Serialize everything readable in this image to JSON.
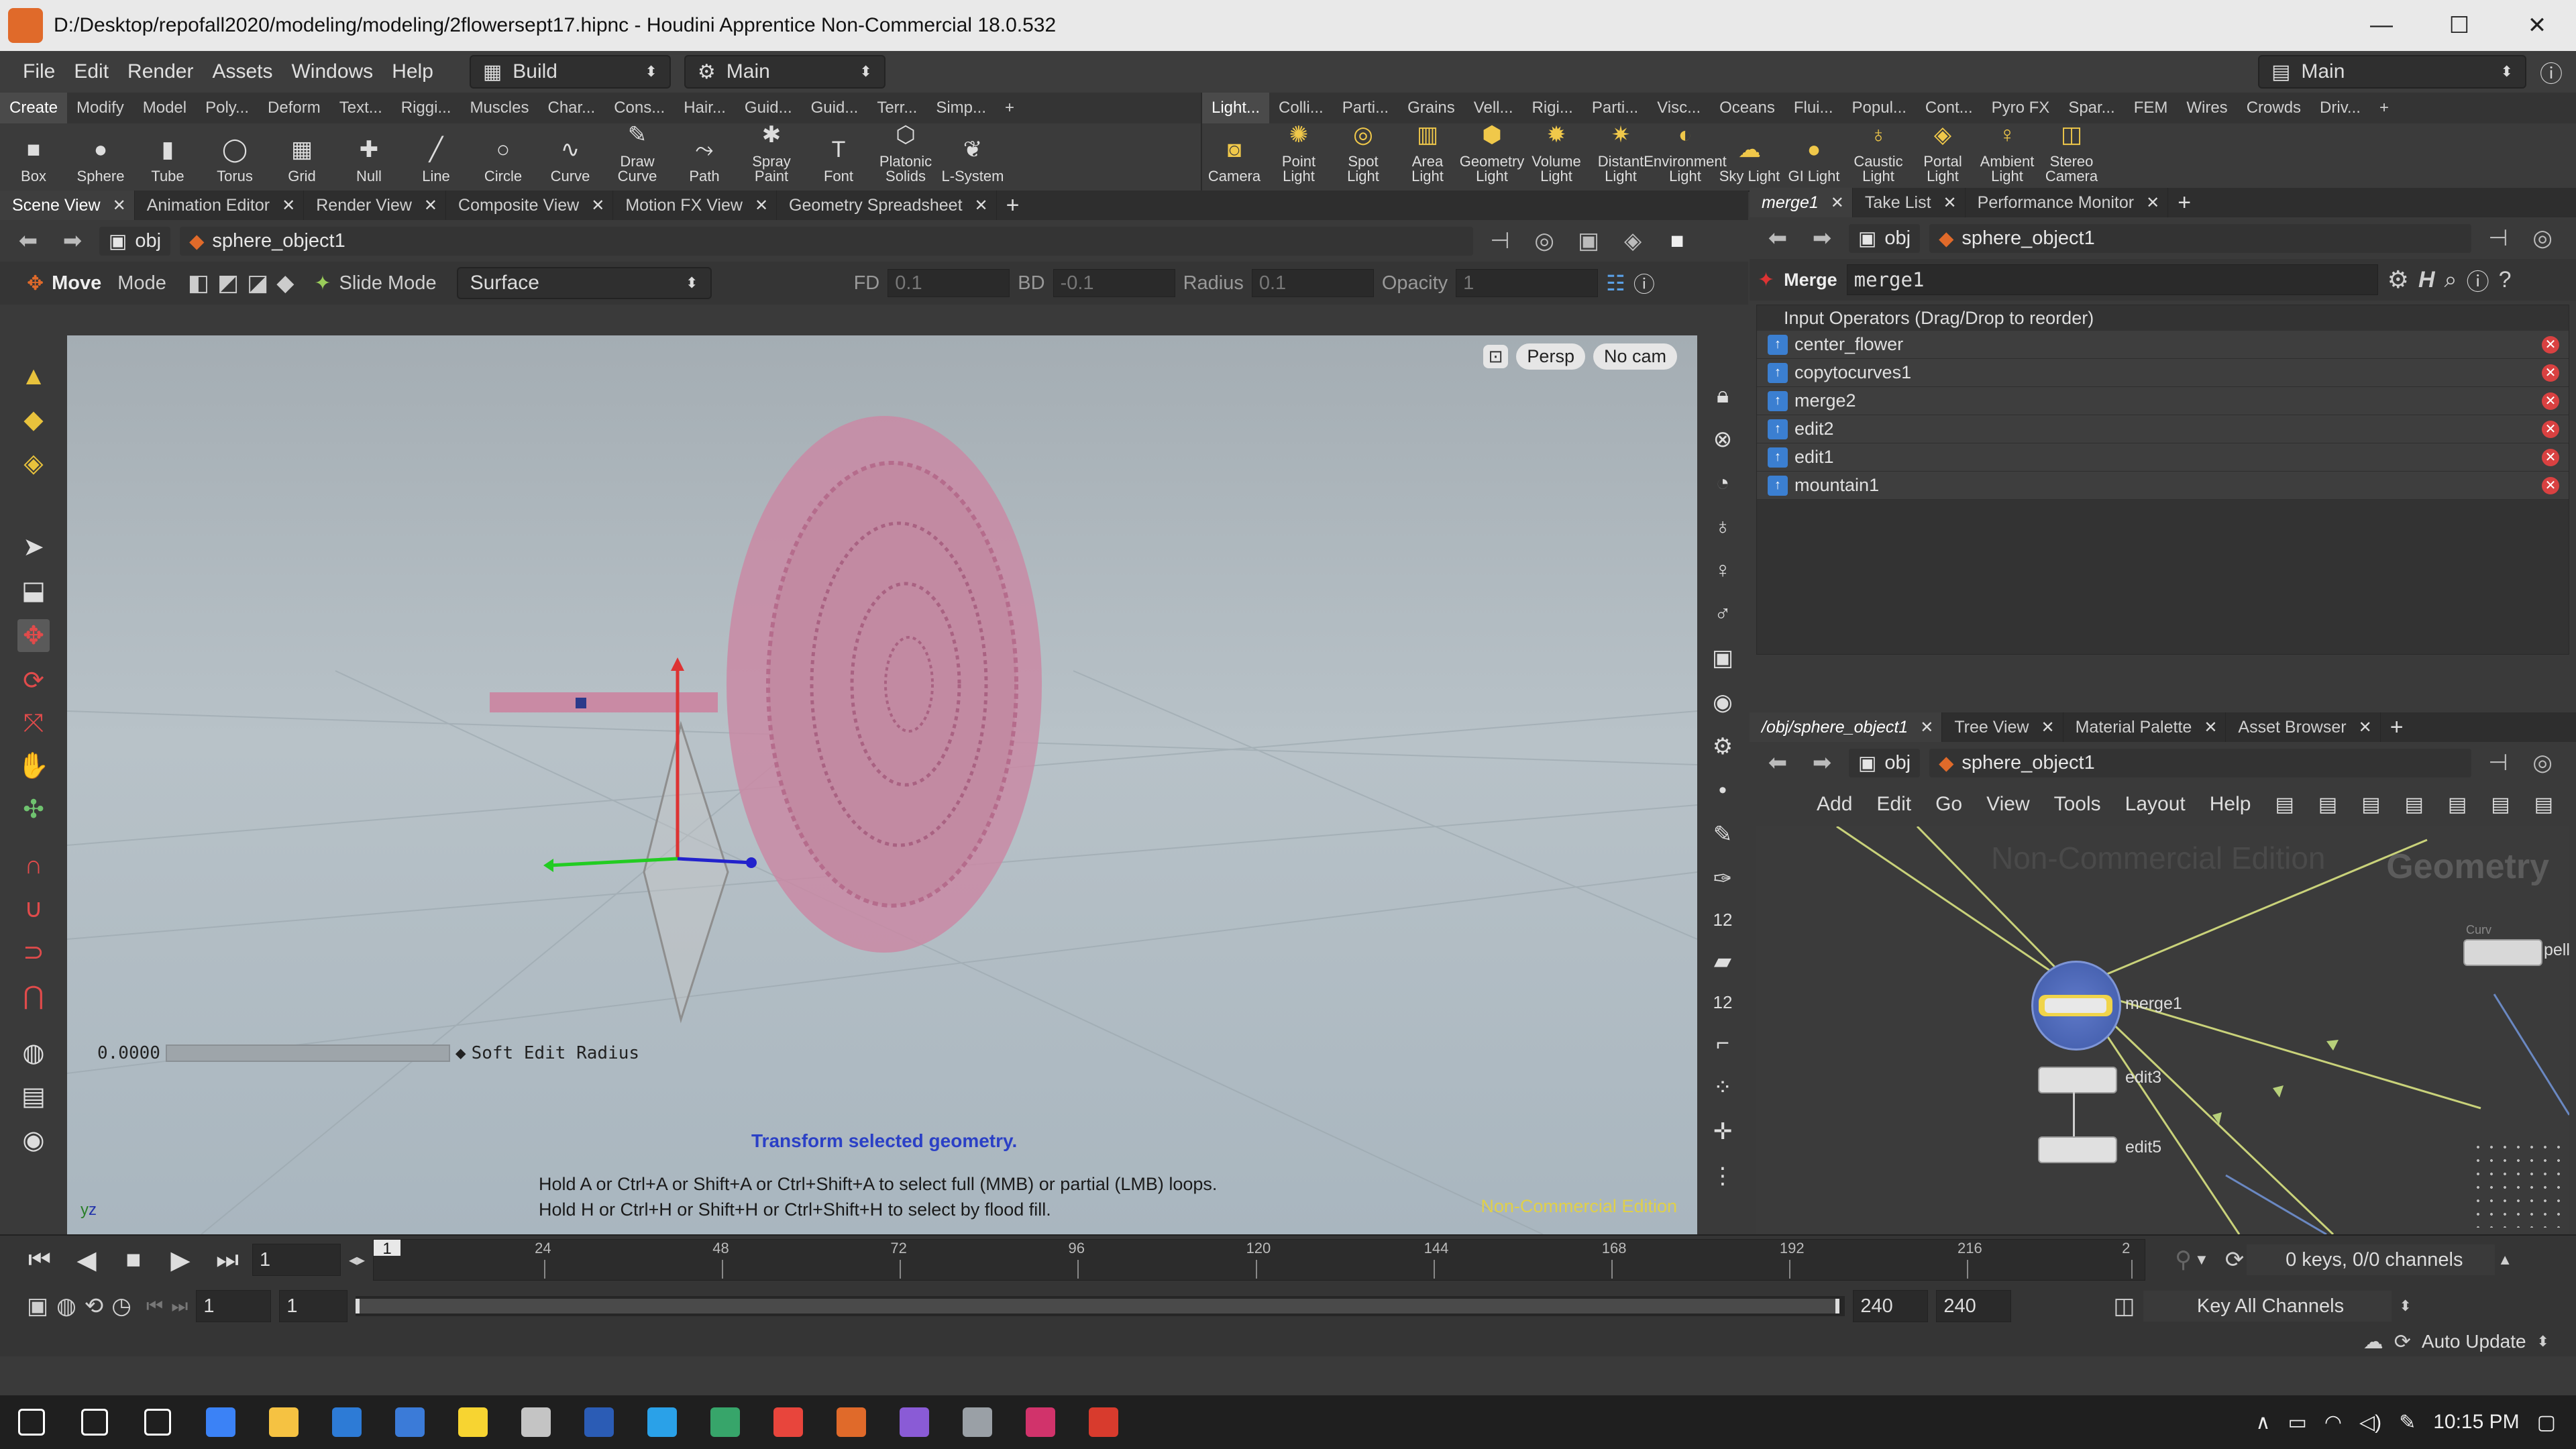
{
  "window": {
    "title": "D:/Desktop/repofall2020/modeling/modeling/2flowersept17.hipnc - Houdini Apprentice Non-Commercial 18.0.532",
    "controls": [
      "—",
      "☐",
      "✕"
    ]
  },
  "menubar": {
    "items": [
      "File",
      "Edit",
      "Render",
      "Assets",
      "Windows",
      "Help"
    ],
    "desktop_label": "Build",
    "context_label": "Main",
    "right_label": "Main"
  },
  "shelf_left": {
    "tabs": [
      "Create",
      "Modify",
      "Model",
      "Poly...",
      "Deform",
      "Text...",
      "Riggi...",
      "Muscles",
      "Char...",
      "Cons...",
      "Hair...",
      "Guid...",
      "Guid...",
      "Terr...",
      "Simp..."
    ],
    "tools": [
      {
        "label": "Box",
        "icon": "box-icon",
        "glyph": "■"
      },
      {
        "label": "Sphere",
        "icon": "sphere-icon",
        "glyph": "●"
      },
      {
        "label": "Tube",
        "icon": "tube-icon",
        "glyph": "▮"
      },
      {
        "label": "Torus",
        "icon": "torus-icon",
        "glyph": "◯"
      },
      {
        "label": "Grid",
        "icon": "grid-icon",
        "glyph": "▦"
      },
      {
        "label": "Null",
        "icon": "null-icon",
        "glyph": "✚"
      },
      {
        "label": "Line",
        "icon": "line-icon",
        "glyph": "╱"
      },
      {
        "label": "Circle",
        "icon": "circle-icon",
        "glyph": "○"
      },
      {
        "label": "Curve",
        "icon": "curve-icon",
        "glyph": "∿"
      },
      {
        "label": "Draw Curve",
        "icon": "draw-curve-icon",
        "glyph": "✎"
      },
      {
        "label": "Path",
        "icon": "path-icon",
        "glyph": "⤳"
      },
      {
        "label": "Spray Paint",
        "icon": "spray-paint-icon",
        "glyph": "✱"
      },
      {
        "label": "Font",
        "icon": "font-icon",
        "glyph": "T"
      },
      {
        "label": "Platonic Solids",
        "icon": "platonic-icon",
        "glyph": "⬡"
      },
      {
        "label": "L-System",
        "icon": "lsystem-icon",
        "glyph": "❦"
      }
    ]
  },
  "shelf_right": {
    "tabs": [
      "Light...",
      "Colli...",
      "Parti...",
      "Grains",
      "Vell...",
      "Rigi...",
      "Parti...",
      "Visc...",
      "Oceans",
      "Flui...",
      "Popul...",
      "Cont...",
      "Pyro FX",
      "Spar...",
      "FEM",
      "Wires",
      "Crowds",
      "Driv..."
    ],
    "tools": [
      {
        "label": "Camera",
        "icon": "camera-icon",
        "glyph": "◙"
      },
      {
        "label": "Point Light",
        "icon": "point-light-icon",
        "glyph": "✺"
      },
      {
        "label": "Spot Light",
        "icon": "spot-light-icon",
        "glyph": "◎"
      },
      {
        "label": "Area Light",
        "icon": "area-light-icon",
        "glyph": "▥"
      },
      {
        "label": "Geometry Light",
        "icon": "geometry-light-icon",
        "glyph": "⬢"
      },
      {
        "label": "Volume Light",
        "icon": "volume-light-icon",
        "glyph": "✹"
      },
      {
        "label": "Distant Light",
        "icon": "distant-light-icon",
        "glyph": "✷"
      },
      {
        "label": "Environment Light",
        "icon": "environment-light-icon",
        "glyph": "◐"
      },
      {
        "label": "Sky Light",
        "icon": "sky-light-icon",
        "glyph": "☁"
      },
      {
        "label": "GI Light",
        "icon": "gi-light-icon",
        "glyph": "●"
      },
      {
        "label": "Caustic Light",
        "icon": "caustic-light-icon",
        "glyph": "♁"
      },
      {
        "label": "Portal Light",
        "icon": "portal-light-icon",
        "glyph": "◈"
      },
      {
        "label": "Ambient Light",
        "icon": "ambient-light-icon",
        "glyph": "♀"
      },
      {
        "label": "Stereo Camera",
        "icon": "stereo-camera-icon",
        "glyph": "◫"
      }
    ]
  },
  "viewer_tabs": [
    "Scene View",
    "Animation Editor",
    "Render View",
    "Composite View",
    "Motion FX View",
    "Geometry Spreadsheet"
  ],
  "viewer_path": {
    "obj": "obj",
    "node": "sphere_object1"
  },
  "viewer_toolbar": {
    "tool": "Move",
    "mode": "Mode",
    "slide_mode": "Slide Mode",
    "surface": "Surface",
    "fd_label": "FD",
    "fd_value": "0.1",
    "bd_label": "BD",
    "bd_value": "-0.1",
    "radius_label": "Radius",
    "radius_value": "0.1",
    "opacity_label": "Opacity",
    "opacity_value": "1"
  },
  "viewport": {
    "persp": "Persp",
    "cam": "No cam",
    "soft_edit_value": "0.0000",
    "soft_edit_label": "Soft Edit Radius",
    "hint_title": "Transform selected geometry.",
    "hint_line1": "Hold A or Ctrl+A or Shift+A or Ctrl+Shift+A to select full (MMB) or partial (LMB) loops.",
    "hint_line2": "Hold H or Ctrl+H or Shift+H or Ctrl+Shift+H to select by flood fill.",
    "watermark": "Non-Commercial Edition",
    "axis_label": "y",
    "axis_label2": "z"
  },
  "params_tabs": [
    "merge1",
    "Take List",
    "Performance Monitor"
  ],
  "params": {
    "node_type": "Merge",
    "node_name": "merge1",
    "input_header": "Input Operators (Drag/Drop to reorder)",
    "inputs": [
      "center_flower",
      "copytocurves1",
      "merge2",
      "edit2",
      "edit1",
      "mountain1"
    ]
  },
  "network_tabs": [
    "/obj/sphere_object1",
    "Tree View",
    "Material Palette",
    "Asset Browser"
  ],
  "network": {
    "menu": [
      "Add",
      "Edit",
      "Go",
      "View",
      "Tools",
      "Layout",
      "Help"
    ],
    "watermark": "Non-Commercial Edition",
    "context_label": "Geometry",
    "nodes": [
      {
        "name": "merge1"
      },
      {
        "name": "edit3"
      },
      {
        "name": "edit5"
      },
      {
        "name": "pell"
      }
    ],
    "node_top_label": "Curv"
  },
  "timeline": {
    "current_frame": "1",
    "ticks": [
      "1",
      "24",
      "48",
      "72",
      "96",
      "120",
      "144",
      "168",
      "192",
      "216",
      "2"
    ],
    "start": "1",
    "start2": "1",
    "end": "240",
    "end2": "240",
    "keys_info": "0 keys, 0/0 channels",
    "key_all": "Key All Channels",
    "auto_update": "Auto Update"
  },
  "taskbar": {
    "time": "10:15 PM",
    "apps": [
      {
        "name": "start-icon",
        "color": "#ffffff"
      },
      {
        "name": "search-icon",
        "color": "#ffffff"
      },
      {
        "name": "task-view-icon",
        "color": "#ffffff"
      },
      {
        "name": "store-icon",
        "color": "#3b82f6"
      },
      {
        "name": "file-explorer-icon",
        "color": "#f5c242"
      },
      {
        "name": "app-icon-k",
        "color": "#2d7bd6"
      },
      {
        "name": "calculator-icon",
        "color": "#3b7bd8"
      },
      {
        "name": "sticky-notes-icon",
        "color": "#f7d431"
      },
      {
        "name": "app-icon-photos",
        "color": "#c4c4c4"
      },
      {
        "name": "word-icon",
        "color": "#2b5cb5"
      },
      {
        "name": "edge-icon",
        "color": "#2aa1e8"
      },
      {
        "name": "app-icon-circle",
        "color": "#37a56a"
      },
      {
        "name": "chrome-icon",
        "color": "#e8453c"
      },
      {
        "name": "houdini-icon",
        "color": "#e06a2a"
      },
      {
        "name": "visual-studio-icon",
        "color": "#8a5bd6"
      },
      {
        "name": "app-icon-bird",
        "color": "#9aa0a6"
      },
      {
        "name": "indesign-icon",
        "color": "#d1336b"
      },
      {
        "name": "acrobat-icon",
        "color": "#d83b2d"
      }
    ]
  }
}
